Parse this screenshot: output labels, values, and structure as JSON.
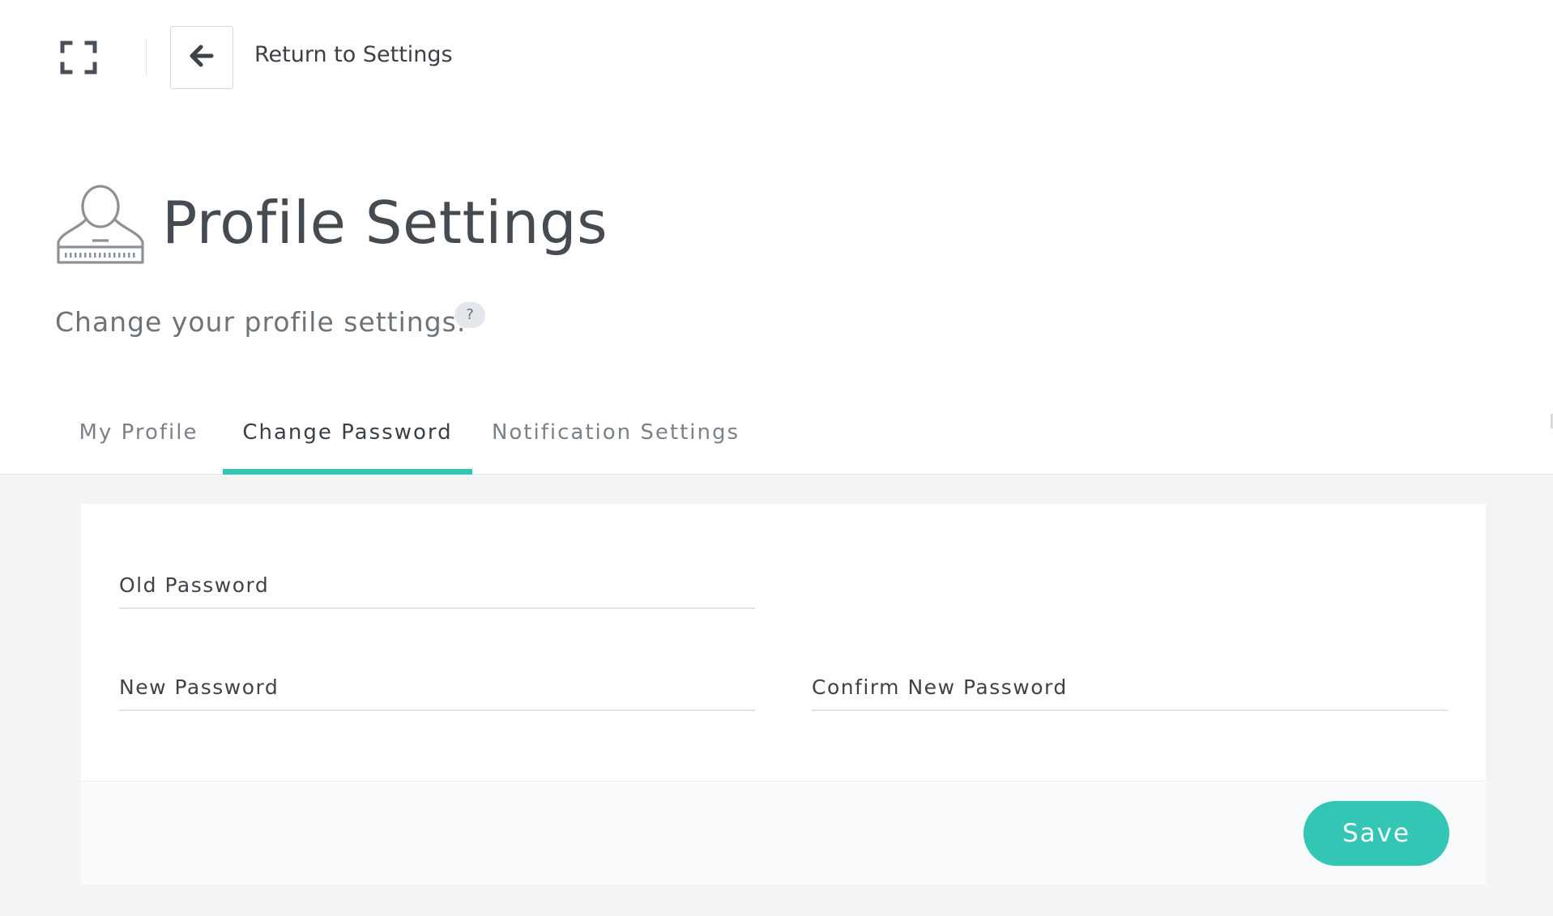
{
  "topbar": {
    "fullscreen_icon": "fullscreen-icon",
    "back_icon": "arrow-left-icon",
    "back_label": "Return to Settings"
  },
  "header": {
    "icon": "user-profile-icon",
    "title": "Profile Settings",
    "subtitle": "Change your profile settings.",
    "help_label": "?"
  },
  "tabs": [
    {
      "label": "My Profile",
      "active": false
    },
    {
      "label": "Change Password",
      "active": true
    },
    {
      "label": "Notification Settings",
      "active": false
    }
  ],
  "form": {
    "old_password": {
      "placeholder": "Old Password",
      "value": ""
    },
    "new_password": {
      "placeholder": "New Password",
      "value": ""
    },
    "confirm_password": {
      "placeholder": "Confirm New Password",
      "value": ""
    },
    "save_label": "Save"
  },
  "colors": {
    "accent": "#34c6b4",
    "background": "#f3f4f5",
    "text": "#464b52"
  }
}
